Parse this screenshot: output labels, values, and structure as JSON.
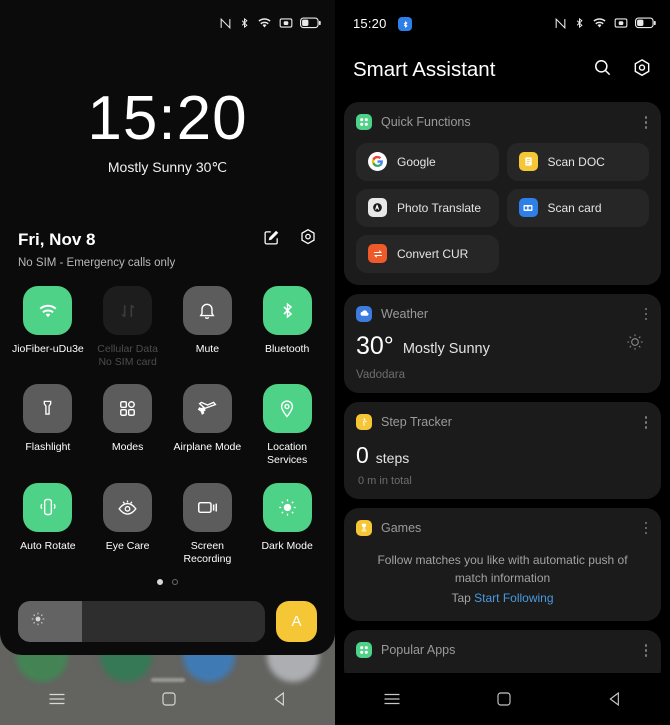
{
  "left": {
    "statusbar": {
      "icons": [
        "nfc-icon",
        "bluetooth-icon",
        "wifi-icon",
        "screen-record-icon",
        "battery-icon"
      ]
    },
    "lockscreen": {
      "clock": "15:20",
      "weather_line": "Mostly Sunny 30℃"
    },
    "shade": {
      "date": "Fri, Nov 8",
      "sim_status": "No SIM - Emergency calls only",
      "edit_icon": "edit-icon",
      "settings_icon": "settings-icon",
      "toggles": [
        {
          "label": "JioFiber-uDu3e",
          "state": "on",
          "icon": "wifi-icon"
        },
        {
          "label": "Cellular Data\nNo SIM card",
          "label_line1": "Cellular Data",
          "label_line2": "No SIM card",
          "state": "disabled",
          "icon": "cellular-data-icon"
        },
        {
          "label": "Mute",
          "state": "off",
          "icon": "bell-icon"
        },
        {
          "label": "Bluetooth",
          "state": "on",
          "icon": "bluetooth-icon"
        },
        {
          "label": "Flashlight",
          "state": "off",
          "icon": "flashlight-icon"
        },
        {
          "label": "Modes",
          "state": "off",
          "icon": "modes-grid-icon"
        },
        {
          "label": "Airplane Mode",
          "state": "off",
          "icon": "airplane-icon"
        },
        {
          "label": "Location\nServices",
          "label_line1": "Location",
          "label_line2": "Services",
          "state": "on",
          "icon": "location-pin-icon"
        },
        {
          "label": "Auto Rotate",
          "state": "on",
          "icon": "auto-rotate-icon"
        },
        {
          "label": "Eye Care",
          "state": "off",
          "icon": "eye-care-icon"
        },
        {
          "label": "Screen\nRecording",
          "label_line1": "Screen",
          "label_line2": "Recording",
          "state": "off",
          "icon": "screen-recording-icon"
        },
        {
          "label": "Dark Mode",
          "state": "on",
          "icon": "dark-mode-icon"
        }
      ],
      "page_dots": {
        "total": 2,
        "active_index": 0
      },
      "brightness": {
        "value_percent": 26,
        "auto_label": "A",
        "icon": "brightness-icon"
      },
      "notification_badge": "bluetooth-notification-icon"
    },
    "navbar": [
      "recents-icon",
      "home-icon",
      "back-icon"
    ]
  },
  "right": {
    "statusbar": {
      "time": "15:20",
      "bt_badge": "bluetooth-icon",
      "icons": [
        "nfc-icon",
        "bluetooth-icon",
        "wifi-icon",
        "screen-record-icon",
        "battery-icon"
      ]
    },
    "header": {
      "title": "Smart Assistant",
      "search_icon": "search-icon",
      "settings_icon": "settings-icon"
    },
    "cards": {
      "quick_functions": {
        "title": "Quick Functions",
        "badge_color": "#4ed287",
        "items": [
          {
            "label": "Google",
            "icon": "google-icon",
            "color": "#ffffff"
          },
          {
            "label": "Scan DOC",
            "icon": "scan-doc-icon",
            "color": "#f5c635"
          },
          {
            "label": "Photo Translate",
            "icon": "photo-translate-icon",
            "color": "#e8e8e8"
          },
          {
            "label": "Scan card",
            "icon": "scan-card-icon",
            "color": "#2f7fe8"
          },
          {
            "label": "Convert CUR",
            "icon": "convert-currency-icon",
            "color": "#ef5a2a"
          }
        ]
      },
      "weather": {
        "title": "Weather",
        "badge_color": "#3d7be0",
        "temperature": "30°",
        "condition": "Mostly Sunny",
        "city": "Vadodara",
        "sun_icon": "sun-icon"
      },
      "step_tracker": {
        "title": "Step Tracker",
        "badge_color": "#f5c635",
        "steps": "0",
        "steps_unit": "steps",
        "distance": "0  m in total"
      },
      "games": {
        "title": "Games",
        "badge_color": "#f5c635",
        "description": "Follow matches you like with automatic push of match information",
        "cta_prefix": "Tap ",
        "cta_link": "Start Following",
        "link_color": "#4a9ae0"
      },
      "popular_apps": {
        "title": "Popular Apps",
        "badge_color": "#4ed287"
      }
    },
    "navbar": [
      "recents-icon",
      "home-icon",
      "back-icon"
    ]
  }
}
